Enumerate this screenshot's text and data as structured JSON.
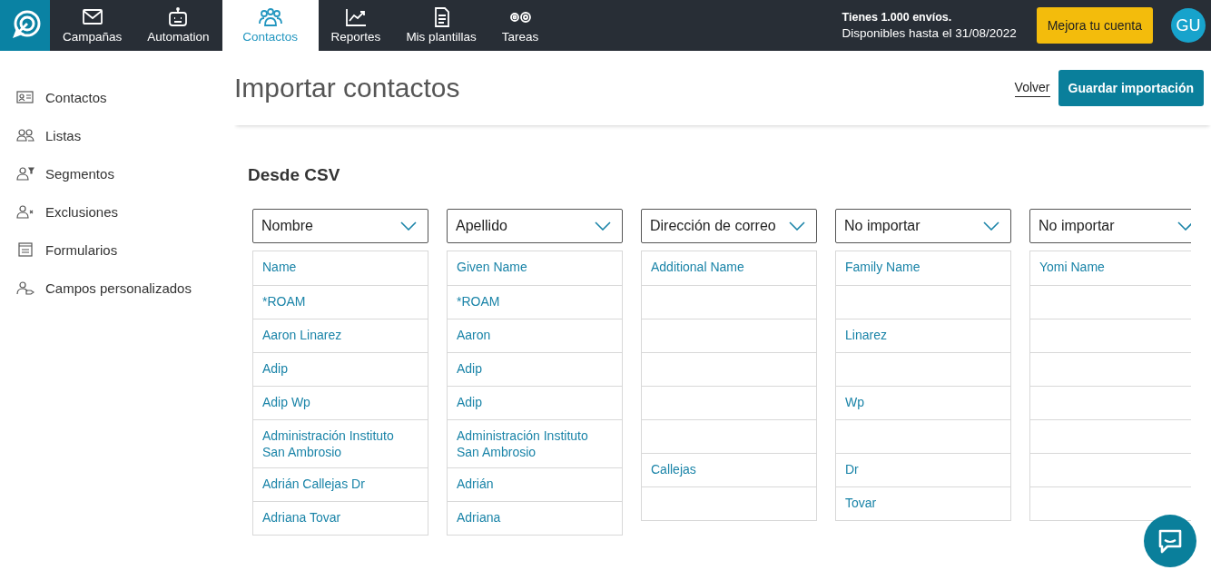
{
  "nav": {
    "items": [
      {
        "label": "Campañas",
        "kind": "envelope",
        "selected": false
      },
      {
        "label": "Automation",
        "kind": "robot",
        "selected": false
      },
      {
        "label": "Contactos",
        "kind": "people",
        "selected": true
      },
      {
        "label": "Reportes",
        "kind": "chart",
        "selected": false
      },
      {
        "label": "Mis plantillas",
        "kind": "document",
        "selected": false
      },
      {
        "label": "Tareas",
        "kind": "gears",
        "selected": false
      }
    ],
    "notice_title": "Tienes 1.000 envíos.",
    "notice_text": "Disponibles hasta el 31/08/2022",
    "upgrade_button": "Mejora tu cuenta",
    "avatar": "GU"
  },
  "sidebar": {
    "items": [
      {
        "label": "Contactos",
        "kind": "card"
      },
      {
        "label": "Listas",
        "kind": "people"
      },
      {
        "label": "Segmentos",
        "kind": "filter"
      },
      {
        "label": "Exclusiones",
        "kind": "exclude"
      },
      {
        "label": "Formularios",
        "kind": "form"
      },
      {
        "label": "Campos personalizados",
        "kind": "tag"
      }
    ]
  },
  "page": {
    "title": "Importar contactos",
    "back_link": "Volver",
    "save_button": "Guardar importación",
    "section_title": "Desde CSV"
  },
  "columns": [
    {
      "field": "Nombre",
      "cells": [
        "Name",
        "*ROAM",
        "Aaron Linarez",
        "Adip",
        "Adip Wp",
        "Administración Instituto San Ambrosio",
        "Adrián Callejas Dr",
        "Adriana Tovar"
      ]
    },
    {
      "field": "Apellido",
      "cells": [
        "Given Name",
        "*ROAM",
        "Aaron",
        "Adip",
        "Adip",
        "Administración Instituto San Ambrosio",
        "Adrián",
        "Adriana"
      ]
    },
    {
      "field": "Dirección de correo",
      "cells": [
        "Additional Name",
        null,
        null,
        null,
        null,
        null,
        "Callejas",
        null
      ]
    },
    {
      "field": "No importar",
      "cells": [
        "Family Name",
        null,
        "Linarez",
        null,
        "Wp",
        null,
        "Dr",
        "Tovar"
      ]
    },
    {
      "field": "No importar",
      "cells": [
        "Yomi Name",
        null,
        null,
        null,
        null,
        null,
        null,
        null
      ]
    }
  ]
}
